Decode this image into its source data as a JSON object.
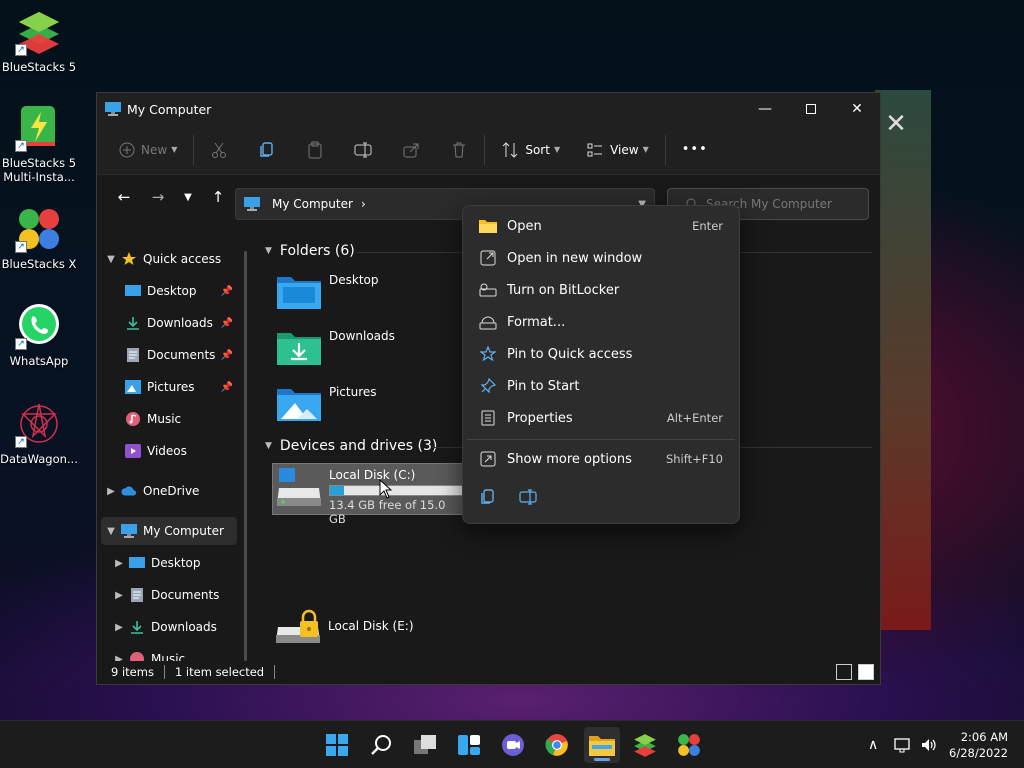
{
  "desktop": {
    "icons": [
      {
        "label": "BlueStacks 5"
      },
      {
        "label": "BlueStacks 5 Multi-Insta..."
      },
      {
        "label": "BlueStacks X"
      },
      {
        "label": "WhatsApp"
      },
      {
        "label": "DataWagon..."
      }
    ]
  },
  "window": {
    "title": "My Computer",
    "toolbar": {
      "new_label": "New",
      "sort_label": "Sort",
      "view_label": "View",
      "more_label": "•••"
    },
    "address": {
      "path": "My Computer",
      "separator": "›"
    },
    "search": {
      "placeholder": "Search My Computer"
    },
    "sidebar": {
      "quick_access": "Quick access",
      "qa_items": [
        {
          "label": "Desktop",
          "pinned": true
        },
        {
          "label": "Downloads",
          "pinned": true
        },
        {
          "label": "Documents",
          "pinned": true
        },
        {
          "label": "Pictures",
          "pinned": true
        },
        {
          "label": "Music"
        },
        {
          "label": "Videos"
        }
      ],
      "onedrive": "OneDrive",
      "my_computer": "My Computer",
      "mc_items": [
        {
          "label": "Desktop"
        },
        {
          "label": "Documents"
        },
        {
          "label": "Downloads"
        },
        {
          "label": "Music"
        }
      ]
    },
    "content": {
      "folders_header": "Folders (6)",
      "folders": [
        {
          "name": "Desktop"
        },
        {
          "name": "Downloads"
        },
        {
          "name": "Pictures"
        }
      ],
      "drives_header": "Devices and drives (3)",
      "drives": [
        {
          "name": "Local Disk (C:)",
          "free": "13.4 GB free of 15.0 GB",
          "used_fraction": 0.107
        },
        {
          "name": "Local Disk (E:)"
        }
      ]
    },
    "status": {
      "items": "9 items",
      "selected": "1 item selected"
    }
  },
  "context_menu": {
    "items": [
      {
        "label": "Open",
        "key": "Enter"
      },
      {
        "label": "Open in new window",
        "key": ""
      },
      {
        "label": "Turn on BitLocker",
        "key": ""
      },
      {
        "label": "Format...",
        "key": ""
      },
      {
        "label": "Pin to Quick access",
        "key": ""
      },
      {
        "label": "Pin to Start",
        "key": ""
      },
      {
        "label": "Properties",
        "key": "Alt+Enter"
      }
    ],
    "more": {
      "label": "Show more options",
      "key": "Shift+F10"
    }
  },
  "taskbar": {
    "clock_time": "2:06 AM",
    "clock_date": "6/28/2022"
  },
  "colors": {
    "accent": "#26a0da",
    "folder_blue": "#2f8fe0",
    "drive_bar": "#26a0da"
  }
}
